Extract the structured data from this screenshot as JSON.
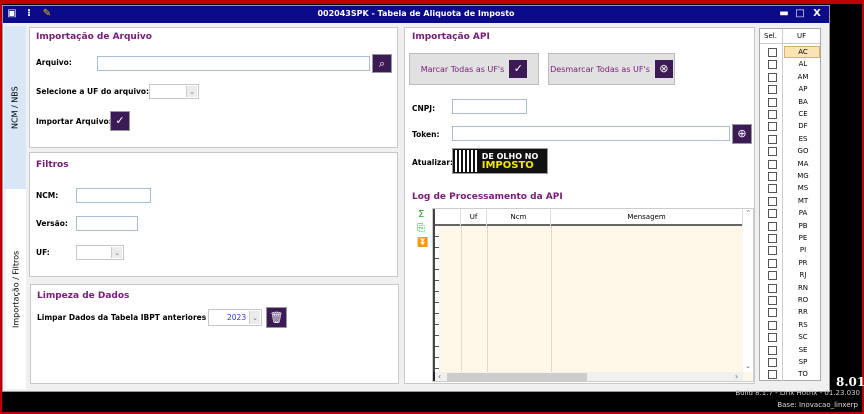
{
  "window": {
    "title": "002043SPK - Tabela de Aliquota de Imposto",
    "icons": [
      "window-menu-icon",
      "traffic-light-icon",
      "wrench-icon"
    ],
    "controls": [
      "minimize",
      "maximize",
      "close"
    ]
  },
  "tabs": [
    {
      "label": "NCM / NBS",
      "active": false
    },
    {
      "label": "Importação / Filtros",
      "active": true
    }
  ],
  "file_import": {
    "title": "Importação de Arquivo",
    "file_label": "Arquivo:",
    "file_value": "",
    "uf_label": "Selecione a UF do arquivo:",
    "uf_value": "",
    "import_label": "Importar Arquivo:"
  },
  "filters": {
    "title": "Filtros",
    "ncm_label": "NCM:",
    "ncm_value": "",
    "version_label": "Versão:",
    "version_value": "",
    "uf_label": "UF:",
    "uf_value": ""
  },
  "cleanup": {
    "title": "Limpeza de Dados",
    "label": "Limpar Dados da Tabela IBPT anteriores a:",
    "year": "2023"
  },
  "api": {
    "title": "Importação API",
    "mark_all": "Marcar Todas as UF's",
    "unmark_all": "Desmarcar Todas as UF's",
    "cnpj_label": "CNPJ:",
    "cnpj_value": "",
    "token_label": "Token:",
    "token_value": "",
    "update_label": "Atualizar:",
    "logo_text": "DE OLHO NO IMPOSTO"
  },
  "log": {
    "title": "Log de Processamento da API",
    "columns": [
      "",
      "Uf",
      "Ncm",
      "Mensagem"
    ],
    "rows": []
  },
  "uf_list": {
    "headers": [
      "Sel.",
      "UF"
    ],
    "selected_row": "AC",
    "items": [
      "AC",
      "AL",
      "AM",
      "AP",
      "BA",
      "CE",
      "DF",
      "ES",
      "GO",
      "MA",
      "MG",
      "MS",
      "MT",
      "PA",
      "PB",
      "PE",
      "PI",
      "PR",
      "RJ",
      "RN",
      "RO",
      "RR",
      "RS",
      "SC",
      "SE",
      "SP",
      "TO"
    ]
  },
  "footer": {
    "version": "8.01",
    "build": "Build 8.1.7 - Linx Hotfix - 01.23.030",
    "base": "Base: Inovacao_linxerp"
  },
  "colors": {
    "titlebar": "#0a0a8a",
    "accent": "#7a1a7a",
    "button": "#3b1a55",
    "grid_bg": "#fff8e8",
    "frame": "#c00000"
  }
}
